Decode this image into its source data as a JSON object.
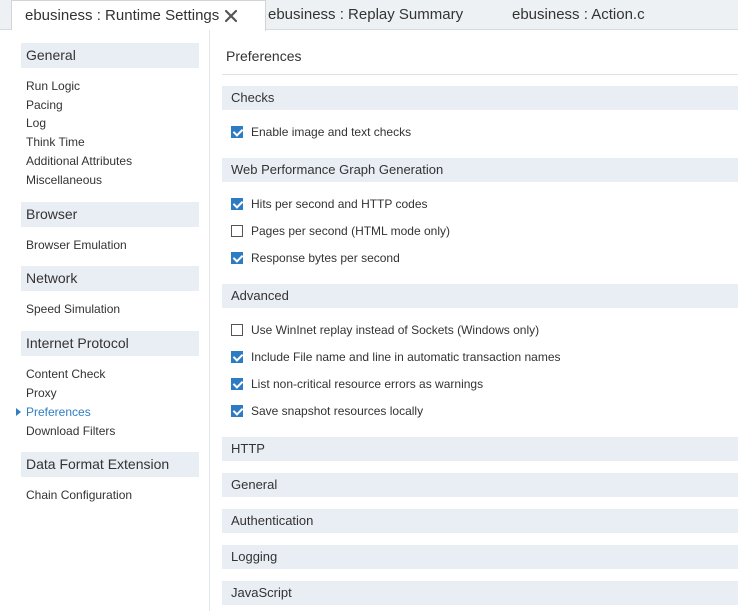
{
  "tabs": [
    {
      "label": "ebusiness : Runtime Settings",
      "active": true
    },
    {
      "label": "ebusiness : Replay Summary",
      "active": false
    },
    {
      "label": "ebusiness : Action.c",
      "active": false
    }
  ],
  "sidebar": {
    "groups": [
      {
        "title": "General",
        "items": [
          "Run Logic",
          "Pacing",
          "Log",
          "Think Time",
          "Additional Attributes",
          "Miscellaneous"
        ]
      },
      {
        "title": "Browser",
        "items": [
          "Browser Emulation"
        ]
      },
      {
        "title": "Network",
        "items": [
          "Speed Simulation"
        ]
      },
      {
        "title": "Internet Protocol",
        "items": [
          "Content Check",
          "Proxy",
          "Preferences",
          "Download Filters"
        ]
      },
      {
        "title": "Data Format Extension",
        "items": [
          "Chain Configuration"
        ]
      }
    ],
    "selected_item": "Preferences"
  },
  "main": {
    "title": "Preferences",
    "sections": [
      {
        "title": "Checks",
        "options": [
          {
            "label": "Enable image and text checks",
            "checked": true
          }
        ]
      },
      {
        "title": "Web Performance Graph Generation",
        "options": [
          {
            "label": "Hits per second and HTTP codes",
            "checked": true
          },
          {
            "label": "Pages per second (HTML mode only)",
            "checked": false
          },
          {
            "label": "Response bytes per second",
            "checked": true
          }
        ]
      },
      {
        "title": "Advanced",
        "options": [
          {
            "label": "Use WinInet replay instead of Sockets (Windows only)",
            "checked": false
          },
          {
            "label": "Include File name and line in automatic transaction names",
            "checked": true
          },
          {
            "label": "List non-critical resource errors as warnings",
            "checked": true
          },
          {
            "label": "Save snapshot resources locally",
            "checked": true
          }
        ]
      },
      {
        "title": "HTTP",
        "options": []
      },
      {
        "title": "General",
        "options": []
      },
      {
        "title": "Authentication",
        "options": []
      },
      {
        "title": "Logging",
        "options": []
      },
      {
        "title": "JavaScript",
        "options": []
      }
    ]
  },
  "icons": {
    "tab_close": "close-icon",
    "selected_marker": "triangle-right-icon"
  },
  "colors": {
    "accent": "#2d7bc2",
    "header_bg": "#e9eef4",
    "tabbar_bg": "#eef1f4"
  }
}
